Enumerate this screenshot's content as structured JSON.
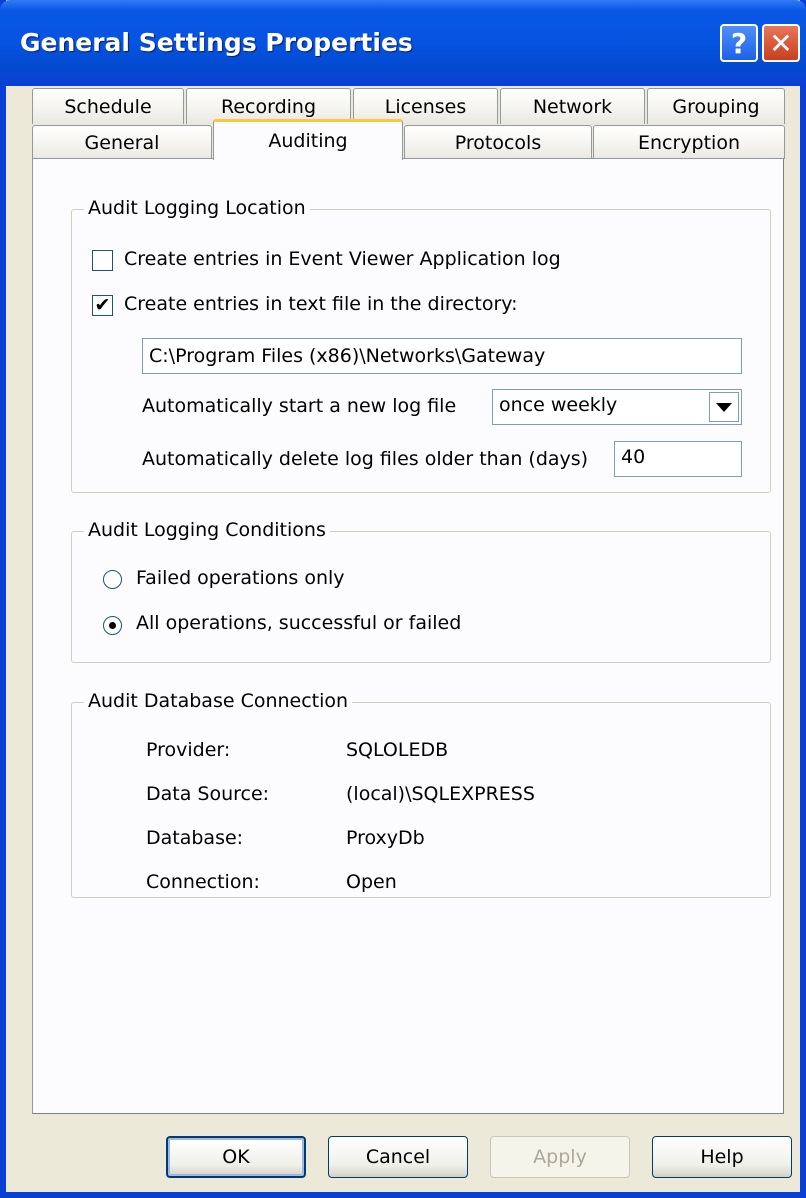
{
  "window": {
    "title": "General Settings Properties",
    "help_glyph": "?",
    "close_glyph": "✕"
  },
  "tabs": {
    "row1": [
      "Schedule",
      "Recording",
      "Licenses",
      "Network",
      "Grouping"
    ],
    "row2": [
      "General",
      "Auditing",
      "Protocols",
      "Encryption"
    ],
    "active": "Auditing"
  },
  "location": {
    "legend": "Audit Logging Location",
    "event_viewer": {
      "label": "Create entries in Event Viewer Application log",
      "checked": false
    },
    "text_file": {
      "label": "Create entries in text file in the directory:",
      "checked": true,
      "glyph": "✔"
    },
    "directory_value": "C:\\Program Files (x86)\\Networks\\Gateway",
    "new_log_label": "Automatically start a new log file",
    "new_log_value": "once weekly",
    "delete_label": "Automatically delete log files older than (days)",
    "delete_value": "40"
  },
  "conditions": {
    "legend": "Audit Logging Conditions",
    "failed_only": "Failed operations only",
    "all_ops": "All operations, successful or failed",
    "selected": "all_ops"
  },
  "db": {
    "legend": "Audit Database Connection",
    "provider_label": "Provider:",
    "provider_value": "SQLOLEDB",
    "source_label": "Data Source:",
    "source_value": "(local)\\SQLEXPRESS",
    "database_label": "Database:",
    "database_value": "ProxyDb",
    "connection_label": "Connection:",
    "connection_value": "Open"
  },
  "buttons": {
    "ok": "OK",
    "cancel": "Cancel",
    "apply": "Apply",
    "help": "Help"
  },
  "colors": {
    "titlebar": "#0554e0",
    "active_tab_accent": "#ffc83c",
    "dialog_bg": "#ece9d8"
  }
}
